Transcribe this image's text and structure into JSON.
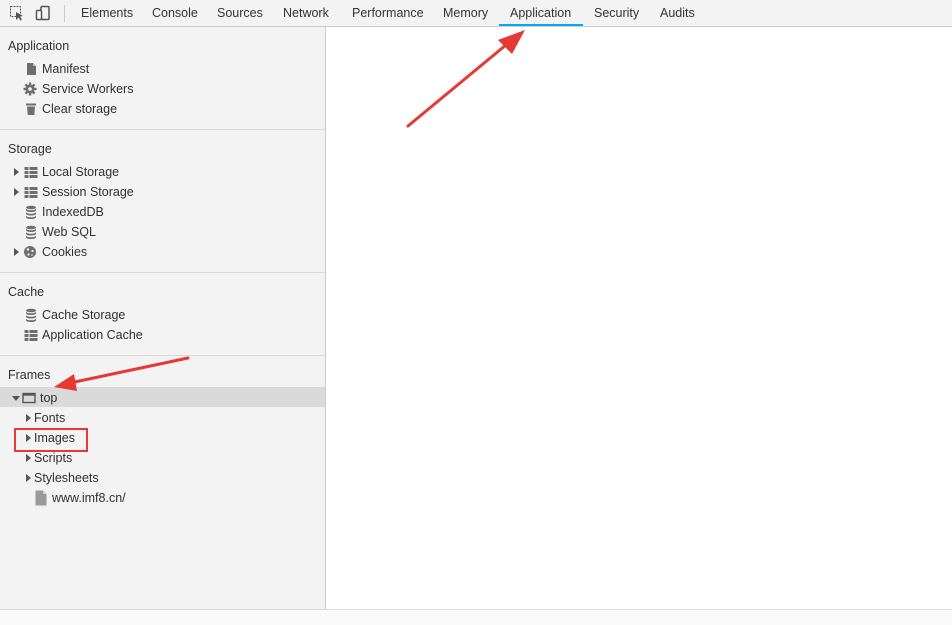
{
  "toolbar": {
    "tabs": [
      {
        "label": "Elements"
      },
      {
        "label": "Console"
      },
      {
        "label": "Sources"
      },
      {
        "label": "Network"
      },
      {
        "label": "Performance"
      },
      {
        "label": "Memory"
      },
      {
        "label": "Application"
      },
      {
        "label": "Security"
      },
      {
        "label": "Audits"
      }
    ],
    "active_tab": "Application",
    "accent_color": "#03a9f4"
  },
  "sidebar": {
    "application": {
      "title": "Application",
      "items": [
        {
          "label": "Manifest",
          "icon": "document-icon"
        },
        {
          "label": "Service Workers",
          "icon": "gear-icon"
        },
        {
          "label": "Clear storage",
          "icon": "trash-icon"
        }
      ]
    },
    "storage": {
      "title": "Storage",
      "items": [
        {
          "label": "Local Storage",
          "icon": "grid-icon"
        },
        {
          "label": "Session Storage",
          "icon": "grid-icon"
        },
        {
          "label": "IndexedDB",
          "icon": "database-icon"
        },
        {
          "label": "Web SQL",
          "icon": "database-icon"
        },
        {
          "label": "Cookies",
          "icon": "cookie-icon"
        }
      ]
    },
    "cache": {
      "title": "Cache",
      "items": [
        {
          "label": "Cache Storage",
          "icon": "database-icon"
        },
        {
          "label": "Application Cache",
          "icon": "grid-icon"
        }
      ]
    },
    "frames": {
      "title": "Frames",
      "top": {
        "label": "top",
        "icon": "frame-icon"
      },
      "children": [
        {
          "label": "Fonts"
        },
        {
          "label": "Images"
        },
        {
          "label": "Scripts"
        },
        {
          "label": "Stylesheets"
        }
      ],
      "document": {
        "label": "www.imf8.cn/",
        "icon": "document-icon"
      }
    }
  },
  "annotations": {
    "arrow_color": "#e53935",
    "highlight_color": "#e53935"
  }
}
